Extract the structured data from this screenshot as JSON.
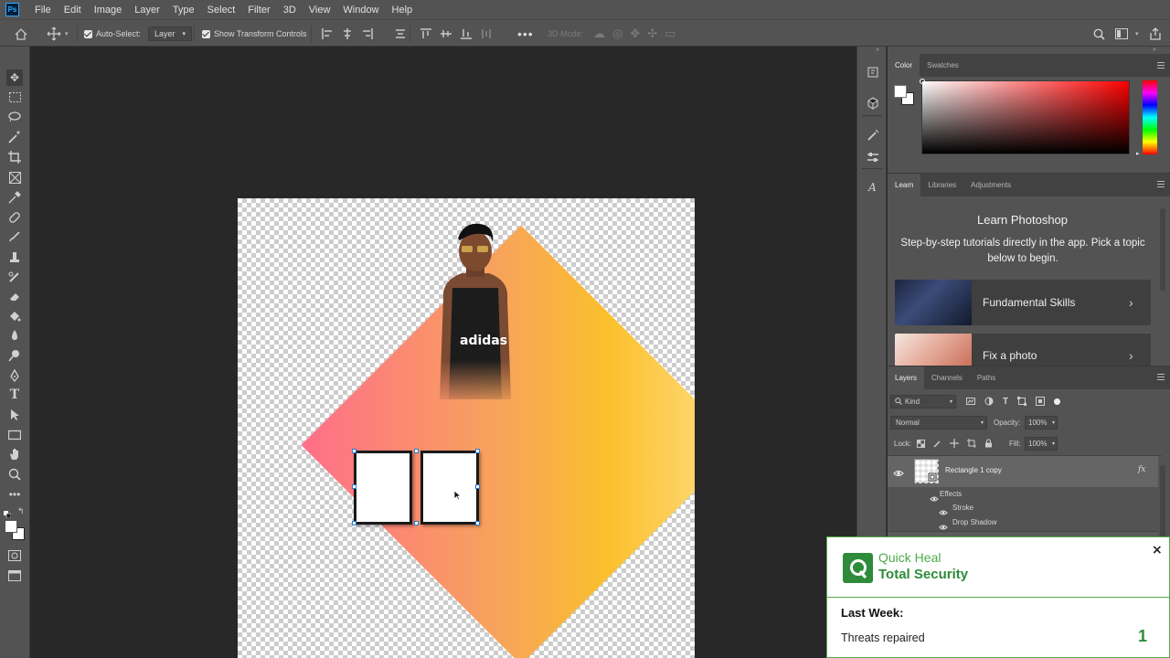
{
  "menu": {
    "logo": "Ps",
    "items": [
      "File",
      "Edit",
      "Image",
      "Layer",
      "Type",
      "Select",
      "Filter",
      "3D",
      "View",
      "Window",
      "Help"
    ]
  },
  "options": {
    "auto_select_label": "Auto-Select:",
    "auto_select_target": "Layer",
    "show_transform_label": "Show Transform Controls",
    "mode_3d_label": "3D Mode:"
  },
  "color_panel": {
    "tabs": [
      "Color",
      "Swatches"
    ]
  },
  "learn_panel": {
    "tabs": [
      "Learn",
      "Libraries",
      "Adjustments"
    ],
    "title": "Learn Photoshop",
    "description": "Step-by-step tutorials directly in the app. Pick a topic below to begin.",
    "cards": [
      "Fundamental Skills",
      "Fix a photo"
    ]
  },
  "layers_panel": {
    "tabs": [
      "Layers",
      "Channels",
      "Paths"
    ],
    "filter_kind": "Kind",
    "blend_mode": "Normal",
    "opacity_label": "Opacity:",
    "opacity_value": "100%",
    "lock_label": "Lock:",
    "fill_label": "Fill:",
    "fill_value": "100%",
    "layer_name": "Rectangle 1 copy",
    "fx_label": "fx",
    "effects_label": "Effects",
    "effects": [
      "Stroke",
      "Drop Shadow"
    ]
  },
  "popup": {
    "brand_line1": "Quick Heal",
    "brand_line2": "Total Security",
    "section_label": "Last Week:",
    "stat_label": "Threats repaired",
    "stat_value": "1",
    "close_glyph": "×",
    "brand_color": "#2e8b3a"
  }
}
